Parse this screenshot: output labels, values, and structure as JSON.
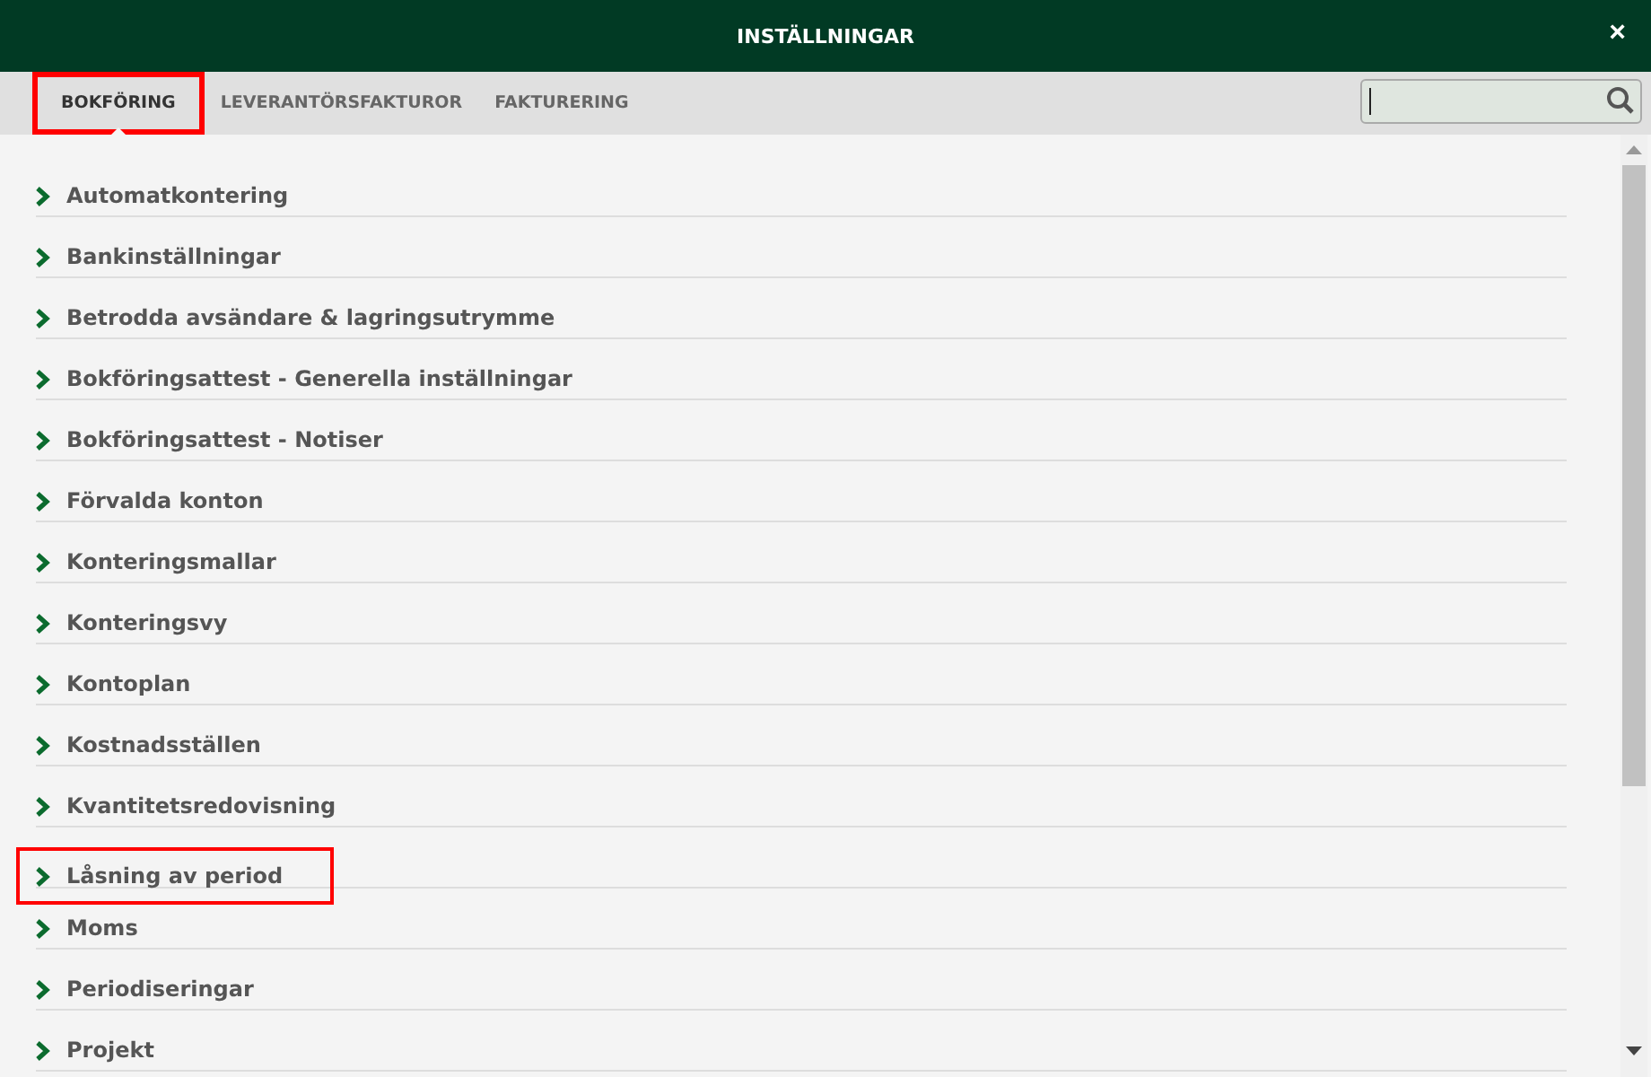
{
  "window": {
    "title": "INSTÄLLNINGAR",
    "close": "×"
  },
  "tabs": [
    {
      "label": "BOKFÖRING",
      "selected": true,
      "highlighted": true
    },
    {
      "label": "LEVERANTÖRSFAKTUROR",
      "selected": false,
      "highlighted": false
    },
    {
      "label": "FAKTURERING",
      "selected": false,
      "highlighted": false
    }
  ],
  "items": [
    {
      "label": "Automatkontering",
      "highlighted": false
    },
    {
      "label": "Bankinställningar",
      "highlighted": false
    },
    {
      "label": "Betrodda avsändare & lagringsutrymme",
      "highlighted": false
    },
    {
      "label": "Bokföringsattest - Generella inställningar",
      "highlighted": false
    },
    {
      "label": "Bokföringsattest - Notiser",
      "highlighted": false
    },
    {
      "label": "Förvalda konton",
      "highlighted": false
    },
    {
      "label": "Konteringsmallar",
      "highlighted": false
    },
    {
      "label": "Konteringsvy",
      "highlighted": false
    },
    {
      "label": "Kontoplan",
      "highlighted": false
    },
    {
      "label": "Kostnadsställen",
      "highlighted": false
    },
    {
      "label": "Kvantitetsredovisning",
      "highlighted": false
    },
    {
      "label": "Låsning av period",
      "highlighted": true
    },
    {
      "label": "Moms",
      "highlighted": false
    },
    {
      "label": "Periodiseringar",
      "highlighted": false
    },
    {
      "label": "Projekt",
      "highlighted": false
    }
  ]
}
